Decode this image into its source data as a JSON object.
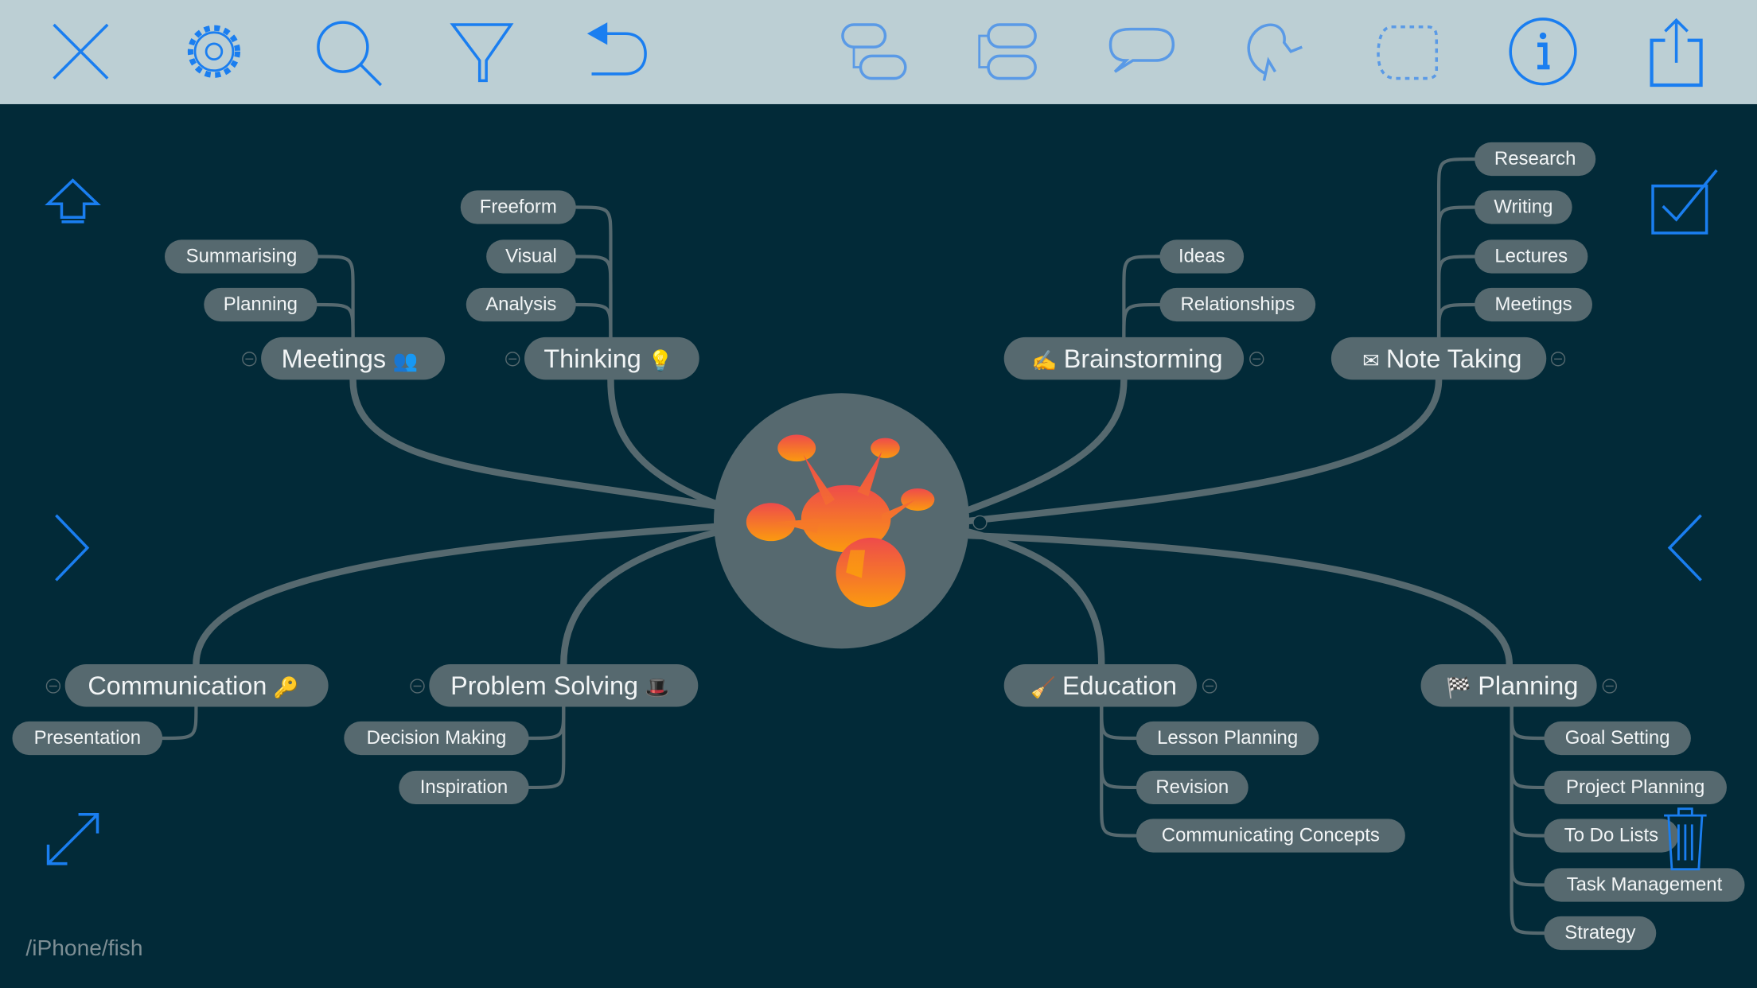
{
  "toolbar": {
    "icons": [
      "close-icon",
      "settings-gear-icon",
      "search-icon",
      "filter-icon",
      "undo-icon",
      "add-child-topic-icon",
      "add-sibling-topic-icon",
      "callout-icon",
      "relationship-icon",
      "boundary-icon",
      "info-icon",
      "share-icon"
    ],
    "icon_color": "#1a7ef0"
  },
  "colors": {
    "background": "#022a38",
    "toolbar": "#bccfd4",
    "node": "#56696f",
    "node_text": "#f2f5f6",
    "accent": "#1a7ef0"
  },
  "map": {
    "central_logo": "imindmap-logo",
    "branches": [
      {
        "label": "Meetings",
        "icon": "👥",
        "children": [
          "Summarising",
          "Planning"
        ]
      },
      {
        "label": "Thinking",
        "icon": "💡",
        "children": [
          "Freeform",
          "Visual",
          "Analysis"
        ]
      },
      {
        "label": "Brainstorming",
        "icon": "✍",
        "children": [
          "Ideas",
          "Relationships"
        ]
      },
      {
        "label": "Note Taking",
        "icon": "✉",
        "children": [
          "Research",
          "Writing",
          "Lectures",
          "Meetings"
        ]
      },
      {
        "label": "Communication",
        "icon": "🔑",
        "children": [
          "Presentation"
        ]
      },
      {
        "label": "Problem Solving",
        "icon": "🎩",
        "children": [
          "Decision Making",
          "Inspiration"
        ]
      },
      {
        "label": "Education",
        "icon": "🧹",
        "children": [
          "Lesson Planning",
          "Revision",
          "Communicating Concepts"
        ]
      },
      {
        "label": "Planning",
        "icon": "🏁",
        "children": [
          "Goal Setting",
          "Project Planning",
          "To Do Lists",
          "Task Management",
          "Strategy"
        ]
      }
    ]
  },
  "side": {
    "home": "home-up-arrow-icon",
    "next": "chevron-right-icon",
    "expand": "expand-icon",
    "tasks": "checkbox-icon",
    "prev": "chevron-left-icon",
    "trash": "trash-icon"
  },
  "path_label": "/iPhone/fish"
}
